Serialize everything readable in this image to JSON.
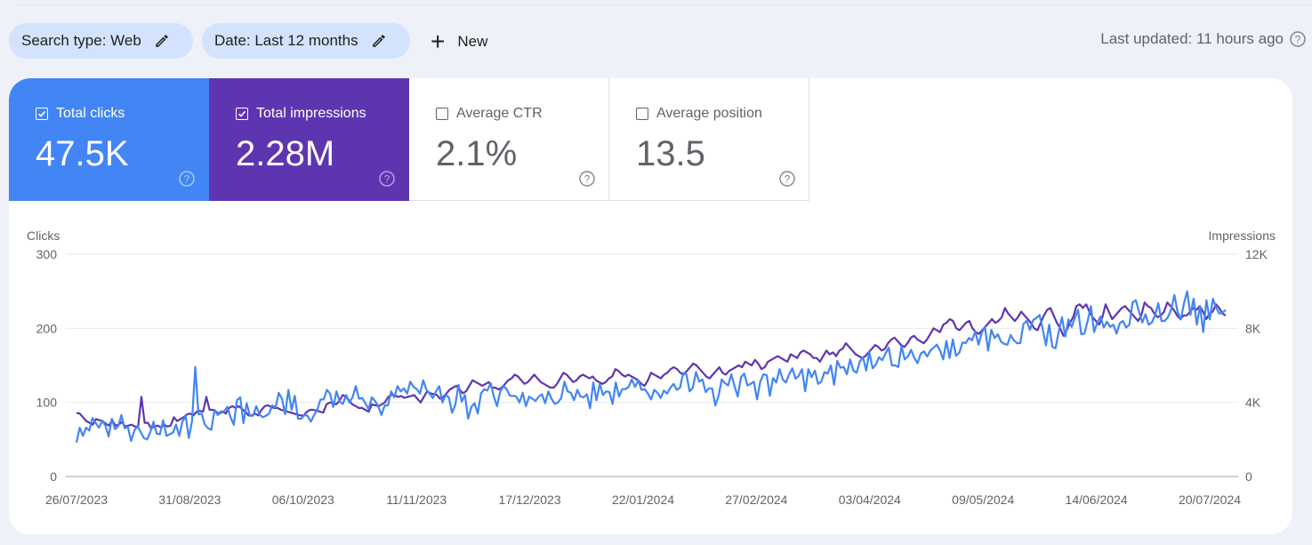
{
  "filters": {
    "search_type": "Search type: Web",
    "date": "Date: Last 12 months",
    "new_label": "New"
  },
  "last_updated": "Last updated: 11 hours ago",
  "metrics": [
    {
      "label": "Total clicks",
      "value": "47.5K",
      "checked": true,
      "color": "#4285f4"
    },
    {
      "label": "Total impressions",
      "value": "2.28M",
      "checked": true,
      "color": "#5e35b1"
    },
    {
      "label": "Average CTR",
      "value": "2.1%",
      "checked": false
    },
    {
      "label": "Average position",
      "value": "13.5",
      "checked": false
    }
  ],
  "chart_data": {
    "type": "line",
    "title": "",
    "ylabel_left": "Clicks",
    "ylabel_right": "Impressions",
    "ylim_left": [
      0,
      300
    ],
    "ylim_right": [
      0,
      12000
    ],
    "yticks_left": [
      "0",
      "100",
      "200",
      "300"
    ],
    "yticks_right": [
      "0",
      "4K",
      "8K",
      "12K"
    ],
    "xticks": [
      "26/07/2023",
      "31/08/2023",
      "06/10/2023",
      "11/11/2023",
      "17/12/2023",
      "22/01/2024",
      "27/02/2024",
      "03/04/2024",
      "09/05/2024",
      "14/06/2024",
      "20/07/2024"
    ],
    "x_start": "26/07/2023",
    "x_end": "24/07/2024",
    "grid": true,
    "series": [
      {
        "name": "Clicks",
        "axis": "left",
        "color": "#4285f4",
        "values": [
          46,
          66,
          55,
          66,
          62,
          79,
          72,
          66,
          75,
          69,
          54,
          78,
          64,
          68,
          83,
          65,
          67,
          48,
          62,
          68,
          60,
          52,
          50,
          60,
          74,
          58,
          57,
          76,
          55,
          57,
          59,
          70,
          55,
          74,
          82,
          52,
          75,
          148,
          84,
          85,
          70,
          65,
          63,
          90,
          83,
          88,
          88,
          94,
          80,
          70,
          103,
          107,
          72,
          99,
          82,
          82,
          95,
          84,
          80,
          82,
          85,
          96,
          93,
          113,
          105,
          84,
          117,
          90,
          109,
          78,
          78,
          83,
          82,
          74,
          83,
          90,
          104,
          104,
          117,
          112,
          94,
          115,
          101,
          98,
          110,
          100,
          107,
          122,
          105,
          106,
          99,
          91,
          107,
          102,
          95,
          83,
          96,
          96,
          115,
          107,
          122,
          115,
          119,
          112,
          128,
          121,
          118,
          112,
          130,
          117,
          112,
          106,
          115,
          122,
          100,
          110,
          107,
          86,
          97,
          124,
          101,
          110,
          78,
          94,
          99,
          85,
          112,
          118,
          116,
          126,
          108,
          95,
          115,
          122,
          118,
          109,
          109,
          108,
          100,
          113,
          95,
          108,
          105,
          102,
          108,
          111,
          99,
          115,
          105,
          98,
          100,
          106,
          128,
          115,
          113,
          103,
          117,
          108,
          107,
          111,
          92,
          127,
          103,
          125,
          110,
          115,
          114,
          98,
          127,
          108,
          118,
          118,
          121,
          131,
          121,
          130,
          117,
          118,
          112,
          104,
          117,
          113,
          106,
          116,
          112,
          120,
          125,
          117,
          120,
          140,
          138,
          115,
          120,
          141,
          128,
          131,
          114,
          119,
          119,
          96,
          109,
          131,
          126,
          123,
          138,
          122,
          108,
          134,
          139,
          123,
          125,
          128,
          104,
          128,
          138,
          137,
          109,
          133,
          127,
          145,
          131,
          127,
          138,
          146,
          132,
          136,
          145,
          115,
          145,
          134,
          143,
          125,
          128,
          141,
          139,
          150,
          124,
          156,
          147,
          148,
          138,
          158,
          143,
          140,
          155,
          161,
          143,
          168,
          146,
          151,
          161,
          157,
          166,
          174,
          150,
          150,
          148,
          176,
          158,
          162,
          171,
          160,
          153,
          166,
          169,
          162,
          170,
          174,
          178,
          170,
          158,
          183,
          160,
          185,
          163,
          167,
          181,
          180,
          187,
          184,
          196,
          178,
          194,
          202,
          170,
          198,
          187,
          192,
          182,
          179,
          178,
          191,
          184,
          180,
          180,
          206,
          210,
          198,
          211,
          214,
          218,
          199,
          177,
          205,
          175,
          173,
          196,
          215,
          189,
          212,
          202,
          214,
          225,
          192,
          193,
          210,
          230,
          195,
          208,
          216,
          201,
          209,
          202,
          205,
          193,
          207,
          210,
          201,
          205,
          235,
          238,
          222,
          208,
          219,
          205,
          208,
          218,
          234,
          210,
          210,
          215,
          225,
          245,
          222,
          212,
          234,
          250,
          218,
          240,
          205,
          230,
          195,
          238,
          212,
          240,
          228,
          220,
          221,
          225
        ]
      },
      {
        "name": "Impressions",
        "axis": "right",
        "color": "#5e35b1",
        "values": [
          3440,
          3400,
          3200,
          3000,
          2900,
          2800,
          3100,
          3050,
          3000,
          2850,
          2750,
          3050,
          2750,
          2800,
          2950,
          2700,
          2750,
          2800,
          2700,
          2700,
          4300,
          2900,
          2900,
          2600,
          2700,
          2750,
          2650,
          2800,
          2700,
          2750,
          3200,
          3000,
          3100,
          3200,
          3350,
          3400,
          3300,
          3500,
          3550,
          3500,
          4300,
          3600,
          3600,
          3500,
          3400,
          3500,
          3400,
          3700,
          3800,
          3700,
          3800,
          3650,
          3500,
          3300,
          3300,
          3400,
          3300,
          3600,
          3800,
          3850,
          3750,
          3700,
          3700,
          3600,
          3550,
          3500,
          3450,
          3400,
          3350,
          3300,
          3300,
          3500,
          3600,
          3600,
          3550,
          3500,
          3450,
          3900,
          4000,
          3950,
          3900,
          4100,
          4400,
          4300,
          4100,
          3900,
          3800,
          3700,
          3700,
          3600,
          3500,
          3900,
          3850,
          3800,
          3900,
          4000,
          4300,
          4400,
          4400,
          4300,
          4350,
          4250,
          4300,
          4350,
          4400,
          4200,
          4000,
          4300,
          4600,
          4500,
          4450,
          4400,
          4200,
          4300,
          4500,
          4700,
          4800,
          4900,
          4700,
          4500,
          4600,
          4900,
          5200,
          5100,
          5000,
          4900,
          5000,
          5100,
          4800,
          4800,
          4700,
          4800,
          5000,
          5200,
          5300,
          5500,
          5400,
          5200,
          5000,
          5100,
          5300,
          5500,
          5300,
          5100,
          5000,
          4900,
          4800,
          4800,
          5000,
          5300,
          5600,
          5500,
          5300,
          5100,
          5200,
          5400,
          5500,
          5400,
          5300,
          5400,
          5200,
          5100,
          5000,
          5100,
          5300,
          5400,
          5800,
          5700,
          5500,
          5400,
          5500,
          5400,
          5300,
          5200,
          5000,
          4900,
          5200,
          5600,
          5500,
          5400,
          5300,
          5500,
          5600,
          5800,
          5900,
          5800,
          5600,
          5500,
          5700,
          5900,
          6100,
          6000,
          5800,
          5600,
          5400,
          5300,
          5500,
          5700,
          5900,
          5600,
          5500,
          5700,
          5800,
          5900,
          6000,
          5900,
          6200,
          6100,
          6000,
          6300,
          6100,
          5800,
          5900,
          6200,
          6300,
          6400,
          6500,
          6400,
          6300,
          6200,
          6600,
          6500,
          6400,
          6700,
          6800,
          6700,
          6600,
          6400,
          6400,
          6200,
          6500,
          6800,
          6600,
          6700,
          6500,
          6800,
          6900,
          7200,
          7000,
          6800,
          6600,
          6500,
          6400,
          6500,
          6700,
          6900,
          7100,
          7000,
          6800,
          6900,
          7200,
          7400,
          7500,
          7300,
          7100,
          7000,
          7200,
          7500,
          7600,
          7400,
          7300,
          7200,
          7400,
          7700,
          8000,
          7900,
          7800,
          8200,
          8300,
          8500,
          8400,
          8000,
          7900,
          8100,
          8300,
          8400,
          8000,
          7800,
          7700,
          7900,
          8100,
          8300,
          8500,
          8300,
          8400,
          8600,
          9100,
          8800,
          8600,
          8400,
          8600,
          8900,
          8700,
          8500,
          8300,
          8000,
          7900,
          8300,
          8700,
          9000,
          9100,
          8700,
          8300,
          8000,
          7600,
          7900,
          8300,
          8600,
          9200,
          9300,
          9100,
          9300,
          8900,
          8600,
          8400,
          8200,
          8600,
          9300,
          8900,
          8500,
          8700,
          8900,
          9100,
          9200,
          9000,
          8800,
          8600,
          8400,
          8700,
          9400,
          9200,
          9100,
          8800,
          8600,
          8700,
          8900,
          9400,
          9200,
          9000,
          8700,
          8500,
          8700,
          8700,
          8900,
          9100,
          9000,
          9200,
          8900,
          8500,
          8800,
          8900,
          9300,
          9100,
          8800,
          8700
        ]
      }
    ]
  }
}
